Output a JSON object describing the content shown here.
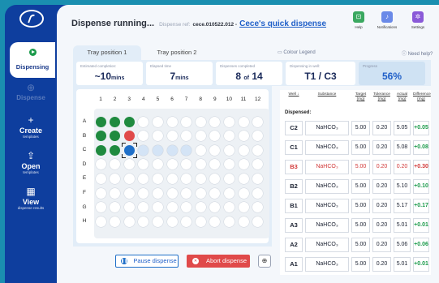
{
  "sidebar": {
    "items": [
      {
        "label": "Dispensing",
        "sub": "",
        "icon": "play-icon"
      },
      {
        "label": "Dispense",
        "sub": "",
        "icon": "plus-circle-icon"
      },
      {
        "label": "Create",
        "sub": "templates",
        "icon": "plus-icon"
      },
      {
        "label": "Open",
        "sub": "templates",
        "icon": "upload-icon"
      },
      {
        "label": "View",
        "sub": "dispense results",
        "icon": "table-icon"
      }
    ]
  },
  "header": {
    "title": "Dispense running...",
    "ref_label": "Dispense ref:",
    "ref_value": "cece.010522.012 -",
    "dispense_name": "Cece's quick dispense",
    "icons": [
      {
        "label": "Help",
        "icon": "help-icon",
        "color": "#3aa860"
      },
      {
        "label": "Notifications",
        "icon": "bell-icon",
        "color": "#6a8ae8"
      },
      {
        "label": "Settings",
        "icon": "gear-icon",
        "color": "#8a5ad8"
      }
    ]
  },
  "tabs": [
    "Tray position 1",
    "Tray position 2"
  ],
  "colour_legend": "Colour Legend",
  "need_help": "Need help?",
  "stats": {
    "estimated_label": "Estimated completion:",
    "estimated_value": "~10",
    "estimated_unit": "mins",
    "elapsed_label": "Elapsed time",
    "elapsed_value": "7",
    "elapsed_unit": "mins",
    "completed_label": "Dispenses completed",
    "completed_value": "8",
    "completed_of": "of",
    "completed_total": "14",
    "well_label": "Dispensing in well:",
    "well_value": "T1 / C3",
    "progress_label": "Progress",
    "progress_value": "56%"
  },
  "plate": {
    "columns": [
      "1",
      "2",
      "3",
      "4",
      "5",
      "6",
      "7",
      "8",
      "9",
      "10",
      "11",
      "12"
    ],
    "rows": [
      "A",
      "B",
      "C",
      "D",
      "E",
      "F",
      "G",
      "H"
    ],
    "states": {
      "A": [
        "g",
        "g",
        "g",
        "",
        "",
        "",
        "",
        "",
        "",
        "",
        "",
        ""
      ],
      "B": [
        "g",
        "g",
        "r",
        "",
        "",
        "",
        "",
        "",
        "",
        "",
        "",
        ""
      ],
      "C": [
        "g",
        "g",
        "b",
        "lb",
        "lb",
        "lb",
        "lb",
        "",
        "",
        "",
        "",
        ""
      ]
    }
  },
  "buttons": {
    "pause": "Pause dispense",
    "abort": "Abort dispense"
  },
  "table": {
    "headers": [
      {
        "label": "Well ↓",
        "unit": ""
      },
      {
        "label": "Substance",
        "unit": ""
      },
      {
        "label": "Target",
        "unit": "(mg)"
      },
      {
        "label": "Tolerance",
        "unit": "(mg)"
      },
      {
        "label": "Actual",
        "unit": "(mg)"
      },
      {
        "label": "Difference",
        "unit": "(mg)"
      }
    ],
    "section": "Dispensed:",
    "rows": [
      {
        "well": "C2",
        "substance": "NaHCO₃",
        "target": "5.00",
        "tolerance": "0.20",
        "actual": "5.05",
        "diff": "+0.05",
        "error": false
      },
      {
        "well": "C1",
        "substance": "NaHCO₃",
        "target": "5.00",
        "tolerance": "0.20",
        "actual": "5.08",
        "diff": "+0.08",
        "error": false
      },
      {
        "well": "B3",
        "substance": "NaHCO₃",
        "target": "5.00",
        "tolerance": "0.20",
        "actual": "0.20",
        "diff": "+0.30",
        "error": true
      },
      {
        "well": "B2",
        "substance": "NaHCO₃",
        "target": "5.00",
        "tolerance": "0.20",
        "actual": "5.10",
        "diff": "+0.10",
        "error": false
      },
      {
        "well": "B1",
        "substance": "NaHCO₃",
        "target": "5.00",
        "tolerance": "0.20",
        "actual": "5.17",
        "diff": "+0.17",
        "error": false
      },
      {
        "well": "A3",
        "substance": "NaHCO₃",
        "target": "5.00",
        "tolerance": "0.20",
        "actual": "5.01",
        "diff": "+0.01",
        "error": false
      },
      {
        "well": "A2",
        "substance": "NaHCO₃",
        "target": "5.00",
        "tolerance": "0.20",
        "actual": "5.06",
        "diff": "+0.06",
        "error": false
      },
      {
        "well": "A1",
        "substance": "NaHCO₃",
        "target": "5.00",
        "tolerance": "0.20",
        "actual": "5.01",
        "diff": "+0.01",
        "error": false
      }
    ]
  }
}
